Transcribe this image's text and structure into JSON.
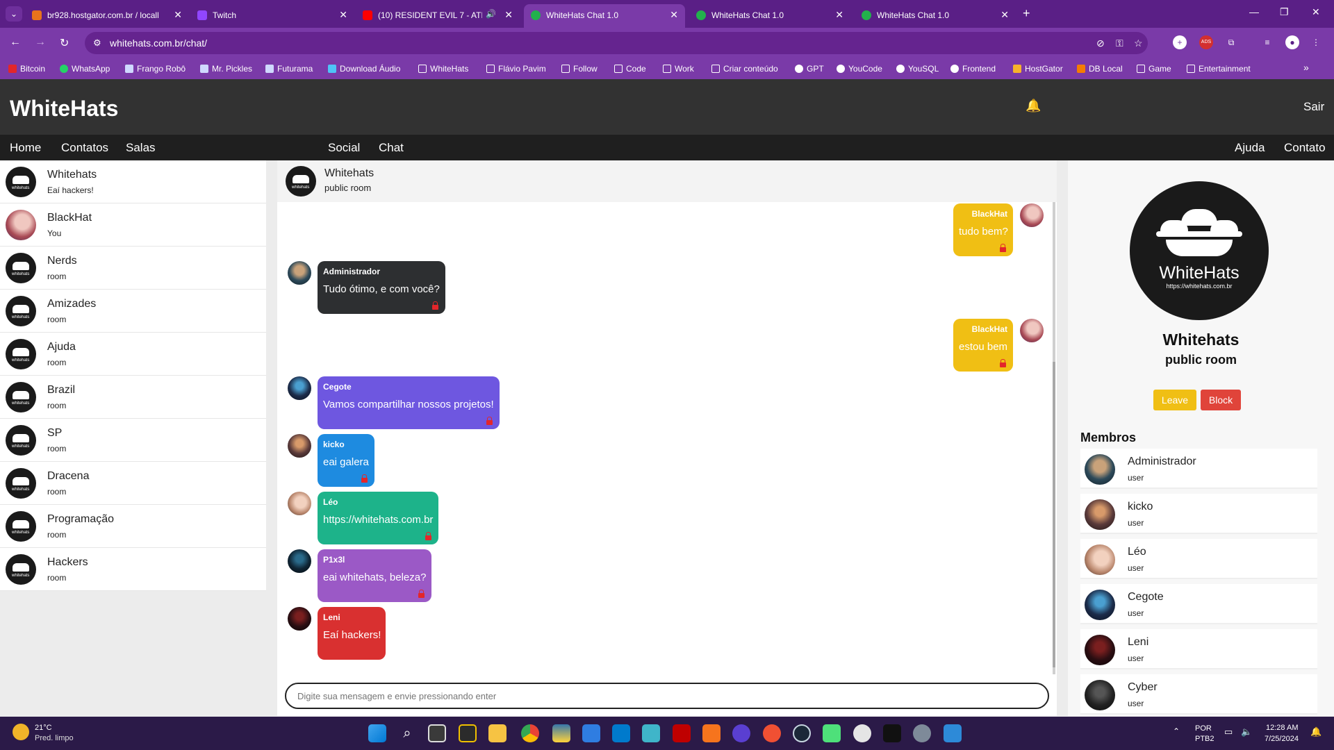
{
  "browser": {
    "tabs": [
      {
        "title": "br928.hostgator.com.br / localh",
        "active": false
      },
      {
        "title": "Twitch",
        "active": false
      },
      {
        "title": "(10) RESIDENT EVIL 7 - ATE",
        "active": false
      },
      {
        "title": "WhiteHats Chat 1.0",
        "active": true
      },
      {
        "title": "WhiteHats Chat 1.0",
        "active": false
      },
      {
        "title": "WhiteHats Chat 1.0",
        "active": false
      }
    ],
    "url": "whitehats.com.br/chat/",
    "bookmarks": [
      "Bitcoin",
      "WhatsApp",
      "Frango Robô",
      "Mr. Pickles",
      "Futurama",
      "Download Áudio",
      "WhiteHats",
      "Flávio Pavim",
      "Follow",
      "Code",
      "Work",
      "Criar conteúdo",
      "GPT",
      "YouCode",
      "YouSQL",
      "Frontend",
      "HostGator",
      "DB Local",
      "Game",
      "Entertainment"
    ]
  },
  "app": {
    "brand": "WhiteHats",
    "logout": "Sair",
    "nav_left": [
      "Home",
      "Contatos",
      "Salas"
    ],
    "nav_center": [
      "Social",
      "Chat"
    ],
    "nav_right": [
      "Ajuda",
      "Contato"
    ]
  },
  "rooms": [
    {
      "name": "Whitehats",
      "sub": "Eaí hackers!"
    },
    {
      "name": "BlackHat",
      "sub": "You"
    },
    {
      "name": "Nerds",
      "sub": "room"
    },
    {
      "name": "Amizades",
      "sub": "room"
    },
    {
      "name": "Ajuda",
      "sub": "room"
    },
    {
      "name": "Brazil",
      "sub": "room"
    },
    {
      "name": "SP",
      "sub": "room"
    },
    {
      "name": "Dracena",
      "sub": "room"
    },
    {
      "name": "Programação",
      "sub": "room"
    },
    {
      "name": "Hackers",
      "sub": "room"
    }
  ],
  "chat": {
    "name": "Whitehats",
    "type": "public room",
    "composer_placeholder": "Digite sua mensagem e envie pressionando enter",
    "messages": [
      {
        "author": "BlackHat",
        "text": "tudo bem?",
        "side": "right",
        "color": "#f0bf14"
      },
      {
        "author": "Administrador",
        "text": "Tudo ótimo, e com você?",
        "side": "left",
        "color": "#2d2f31"
      },
      {
        "author": "BlackHat",
        "text": "estou bem",
        "side": "right",
        "color": "#f0bf14"
      },
      {
        "author": "Cegote",
        "text": "Vamos compartilhar nossos projetos!",
        "side": "left",
        "color": "#6e57e0"
      },
      {
        "author": "kicko",
        "text": "eai galera",
        "side": "left",
        "color": "#1e8be0"
      },
      {
        "author": "Léo",
        "text": "https://whitehats.com.br",
        "side": "left",
        "color": "#1db38a"
      },
      {
        "author": "P1x3l",
        "text": "eai whitehats, beleza?",
        "side": "left",
        "color": "#9b59c6"
      },
      {
        "author": "Leni",
        "text": "Eaí hackers!",
        "side": "left",
        "color": "#d93030"
      }
    ]
  },
  "room_info": {
    "logo_text": "WhiteHats",
    "logo_url": "https://whitehats.com.br",
    "title": "Whitehats",
    "subtitle": "public room",
    "leave_label": "Leave",
    "block_label": "Block",
    "members_heading": "Membros",
    "members": [
      {
        "name": "Administrador",
        "role": "user"
      },
      {
        "name": "kicko",
        "role": "user"
      },
      {
        "name": "Léo",
        "role": "user"
      },
      {
        "name": "Cegote",
        "role": "user"
      },
      {
        "name": "Leni",
        "role": "user"
      },
      {
        "name": "Cyber",
        "role": "user"
      }
    ]
  },
  "taskbar": {
    "temperature": "21°C",
    "condition": "Pred. limpo",
    "lang": "POR",
    "layout": "PTB2",
    "time": "12:28 AM",
    "date": "7/25/2024"
  },
  "colors": {
    "tabbar": "#5a1f86",
    "toolbar": "#7a3aa8",
    "app_header": "#323232",
    "app_nav": "#1f1f1f",
    "leave": "#f0bf14",
    "block": "#e0443a"
  }
}
